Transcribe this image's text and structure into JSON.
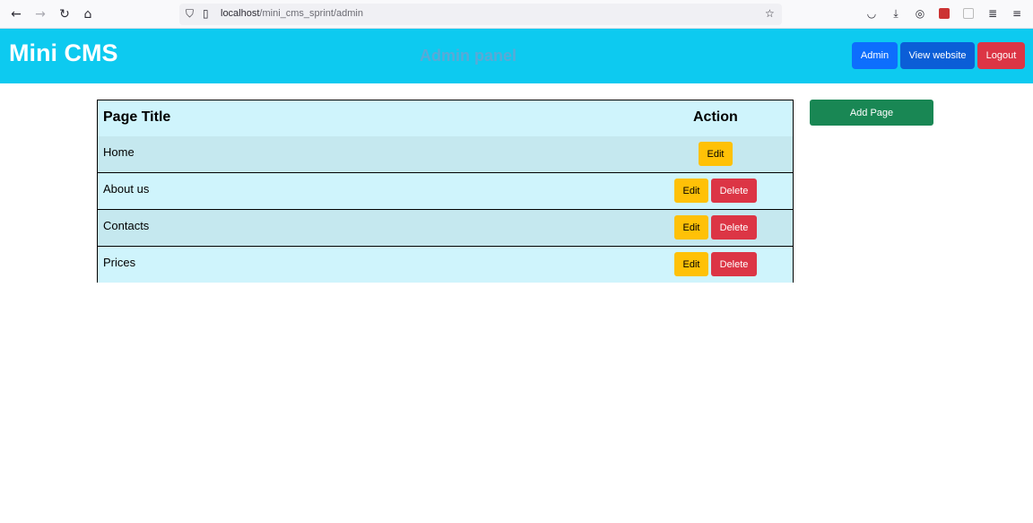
{
  "browser": {
    "url_host": "localhost",
    "url_path": "/mini_cms_sprint/admin"
  },
  "header": {
    "brand": "Mini CMS",
    "panel_title": "Admin panel",
    "buttons": {
      "admin": "Admin",
      "view_website": "View website",
      "logout": "Logout"
    }
  },
  "table": {
    "headers": {
      "title": "Page Title",
      "action": "Action"
    },
    "rows": [
      {
        "title": "Home",
        "edit": "Edit"
      },
      {
        "title": "About us",
        "edit": "Edit",
        "delete": "Delete"
      },
      {
        "title": "Contacts",
        "edit": "Edit",
        "delete": "Delete"
      },
      {
        "title": "Prices",
        "edit": "Edit",
        "delete": "Delete"
      }
    ]
  },
  "sidebar": {
    "add_page": "Add Page"
  },
  "colors": {
    "header_bg": "#0dcaf0",
    "admin_btn": "#0d6efd",
    "view_btn": "#0b5ed7",
    "logout_btn": "#dc3545",
    "edit_btn": "#ffc107",
    "delete_btn": "#dc3545",
    "add_btn": "#198754",
    "table_bg": "#cff4fc"
  }
}
